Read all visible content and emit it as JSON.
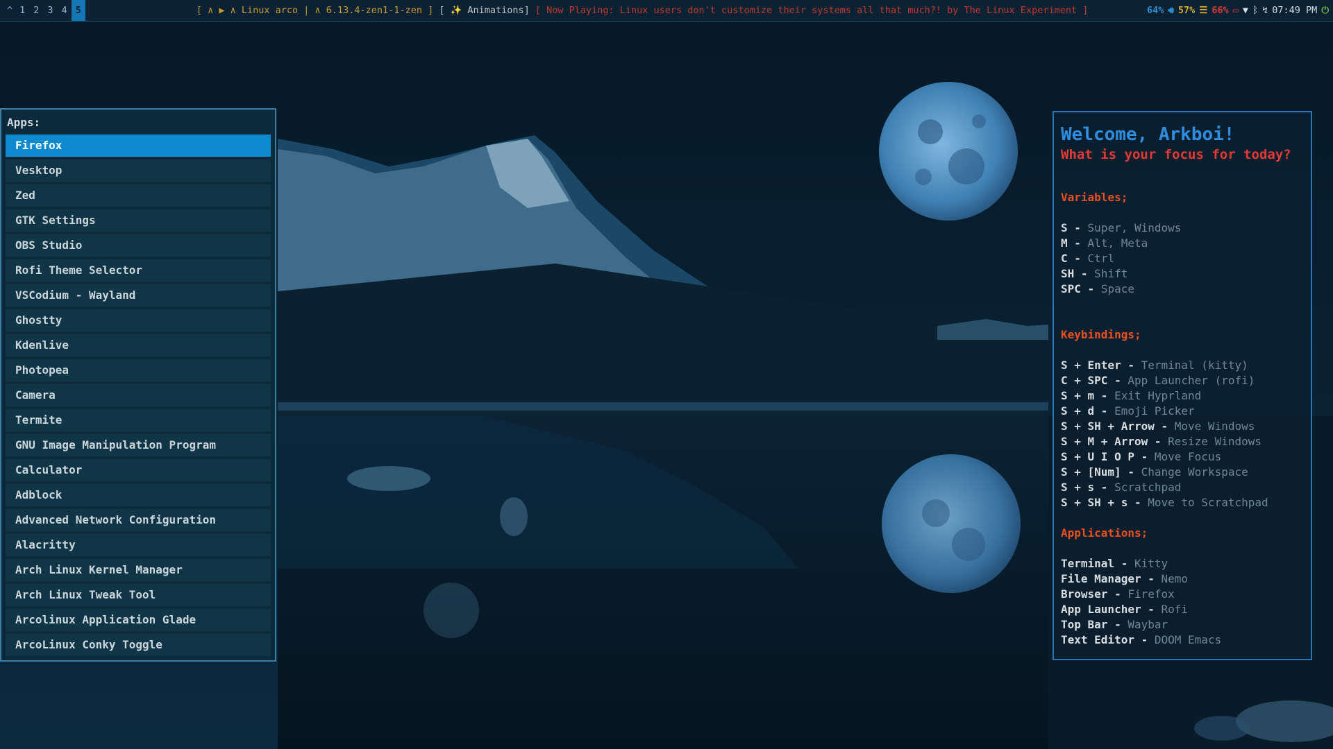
{
  "topbar": {
    "arch_glyph": "^",
    "workspaces": [
      "1",
      "2",
      "3",
      "4",
      "5"
    ],
    "active_workspace": "5",
    "system_info": "[ ∧ ▶ ∧ Linux arco | ∧ 6.13.4-zen1-1-zen ]",
    "animations": "[ ✨ Animations]",
    "now_playing": "[ Now Playing: Linux users don't customize their systems all that much?! by The Linux Experiment ]",
    "cpu": "64%",
    "volume": "57%",
    "memory": "66%",
    "clock": "07:49 PM"
  },
  "launcher": {
    "prompt": "Apps:",
    "selected_index": 0,
    "items": [
      "Firefox",
      "Vesktop",
      "Zed",
      "GTK Settings",
      "OBS Studio",
      "Rofi Theme Selector",
      "VSCodium - Wayland",
      "Ghostty",
      "Kdenlive",
      "Photopea",
      "Camera",
      "Termite",
      "GNU Image Manipulation Program",
      "Calculator",
      "Adblock",
      "Advanced Network Configuration",
      "Alacritty",
      "Arch Linux Kernel Manager",
      "Arch Linux Tweak Tool",
      "Arcolinux Application Glade",
      "ArcoLinux Conky Toggle"
    ]
  },
  "welcome": {
    "title": "Welcome, Arkboi!",
    "subtitle": "What is your focus for today?",
    "variables_heading": "Variables;",
    "variables": [
      {
        "key": "S",
        "value": "Super, Windows"
      },
      {
        "key": "M",
        "value": "Alt, Meta"
      },
      {
        "key": "C",
        "value": "Ctrl"
      },
      {
        "key": "SH",
        "value": "Shift"
      },
      {
        "key": "SPC",
        "value": "Space"
      }
    ],
    "keybindings_heading": "Keybindings;",
    "keybindings": [
      {
        "key": "S + Enter",
        "value": "Terminal (kitty)"
      },
      {
        "key": "C + SPC",
        "value": "App Launcher (rofi)"
      },
      {
        "key": "S + m",
        "value": "Exit Hyprland"
      },
      {
        "key": "S + d",
        "value": "Emoji Picker"
      },
      {
        "key": "S + SH + Arrow",
        "value": "Move Windows"
      },
      {
        "key": "S + M + Arrow",
        "value": "Resize Windows"
      },
      {
        "key": "S + U I O P",
        "value": "Move Focus"
      },
      {
        "key": "S + [Num]",
        "value": "Change Workspace"
      },
      {
        "key": "S + s",
        "value": "Scratchpad"
      },
      {
        "key": "S + SH + s",
        "value": "Move to Scratchpad"
      }
    ],
    "applications_heading": "Applications;",
    "applications": [
      {
        "key": "Terminal",
        "value": "Kitty"
      },
      {
        "key": "File Manager",
        "value": "Nemo"
      },
      {
        "key": "Browser",
        "value": "Firefox"
      },
      {
        "key": "App Launcher",
        "value": "Rofi"
      },
      {
        "key": "Top Bar",
        "value": "Waybar"
      },
      {
        "key": "Text Editor",
        "value": " DOOM Emacs"
      }
    ]
  },
  "colors": {
    "accent": "#0e8ad0",
    "welcome_title": "#2f8de0",
    "welcome_sub": "#e53935",
    "heading": "#e8501f"
  }
}
